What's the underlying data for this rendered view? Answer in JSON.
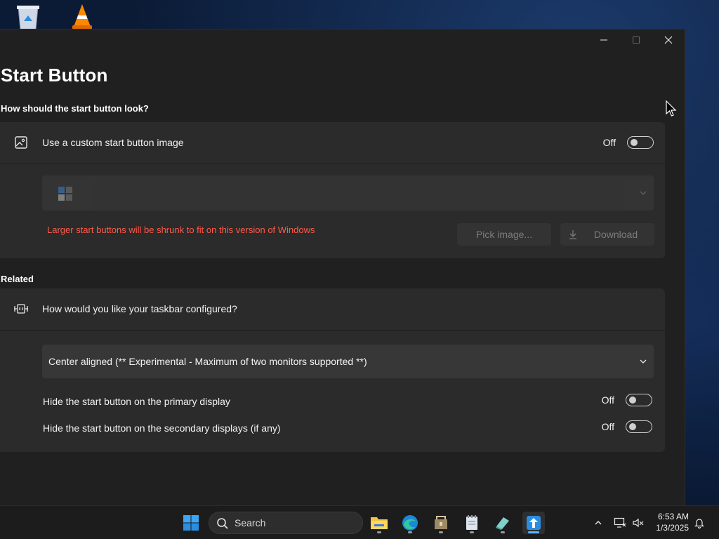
{
  "window": {
    "title": "Start Button",
    "controls": {
      "minimize": "minimize",
      "maximize": "maximize",
      "close": "close"
    }
  },
  "sections": {
    "look": {
      "label": "How should the start button look?",
      "custom_image": {
        "label": "Use a custom start button image",
        "state": "Off",
        "icon": "image-icon"
      },
      "style_combo": {
        "selected": ""
      },
      "warning": "Larger start buttons will be shrunk to fit on this version of Windows",
      "pick_image_label": "Pick image...",
      "download_label": "Download"
    },
    "related": {
      "label": "Related",
      "taskbar": {
        "label": "How would you like your taskbar configured?",
        "icon": "taskbar-icon",
        "combo_selected": "Center aligned (** Experimental - Maximum of two monitors supported **)"
      },
      "hide_primary": {
        "label": "Hide the start button on the primary display",
        "state": "Off"
      },
      "hide_secondary": {
        "label": "Hide the start button on the secondary displays (if any)",
        "state": "Off"
      }
    }
  },
  "taskbar": {
    "search_placeholder": "Search",
    "apps": [
      "start-icon",
      "file-explorer-icon",
      "edge-icon",
      "app-package-icon",
      "notepad-icon",
      "eraser-icon",
      "start11-icon"
    ],
    "clock_time": "6:53 AM",
    "clock_date": "1/3/2025"
  },
  "colors": {
    "window_bg": "#202020",
    "card_bg": "#2b2b2b",
    "combo_bg": "#373737",
    "warning": "#ff5a4a",
    "accent": "#5fb2ff"
  }
}
